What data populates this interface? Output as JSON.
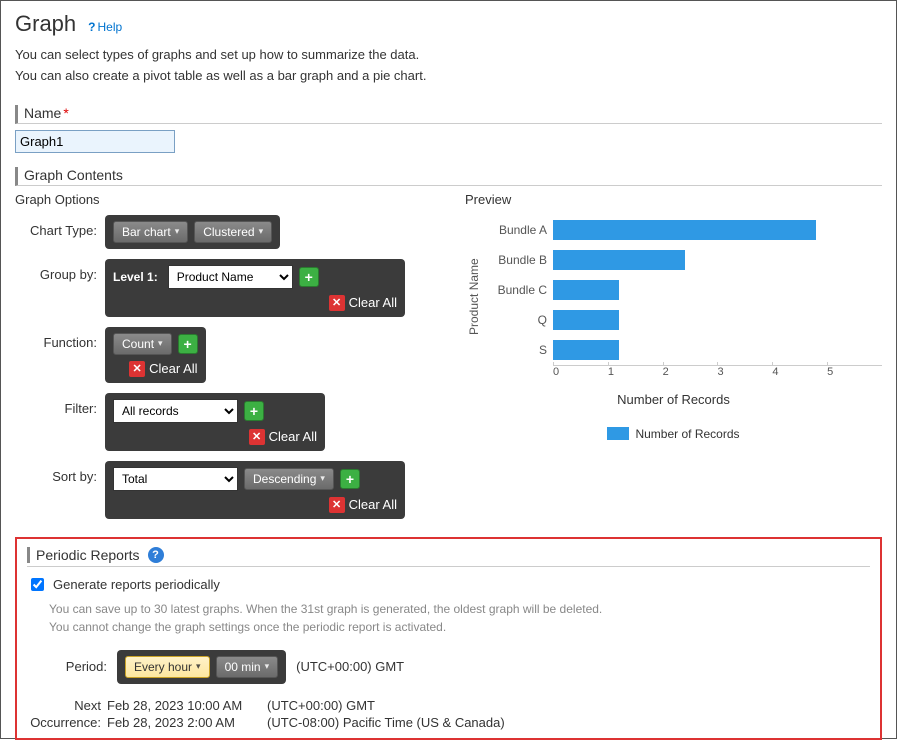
{
  "header": {
    "title": "Graph",
    "help": "Help"
  },
  "description": {
    "line1": "You can select types of graphs and set up how to summarize the data.",
    "line2": "You can also create a pivot table as well as a bar graph and a pie chart."
  },
  "name_section": {
    "label": "Name",
    "value": "Graph1"
  },
  "contents_section": {
    "label": "Graph Contents"
  },
  "options": {
    "heading": "Graph Options",
    "chart_type": {
      "label": "Chart Type:",
      "primary": "Bar chart",
      "secondary": "Clustered"
    },
    "group_by": {
      "label": "Group by:",
      "level_label": "Level 1:",
      "value": "Product Name",
      "clear": "Clear All"
    },
    "function": {
      "label": "Function:",
      "value": "Count",
      "clear": "Clear All"
    },
    "filter": {
      "label": "Filter:",
      "value": "All records",
      "clear": "Clear All"
    },
    "sort_by": {
      "label": "Sort by:",
      "field": "Total",
      "direction": "Descending",
      "clear": "Clear All"
    }
  },
  "preview": {
    "heading": "Preview"
  },
  "chart_data": {
    "type": "bar",
    "orientation": "horizontal",
    "categories": [
      "Bundle A",
      "Bundle B",
      "Bundle C",
      "Q",
      "S"
    ],
    "values": [
      4,
      2,
      1,
      1,
      1
    ],
    "ylabel": "Product Name",
    "xlabel": "Number of Records",
    "xlim": [
      0,
      5
    ],
    "xticks": [
      0,
      1,
      2,
      3,
      4,
      5
    ],
    "legend": "Number of Records",
    "bar_color": "#2f99e4"
  },
  "periodic": {
    "heading": "Periodic Reports",
    "checkbox_label": "Generate reports periodically",
    "checked": true,
    "note_line1": "You can save up to 30 latest graphs. When the 31st graph is generated, the oldest graph will be deleted.",
    "note_line2": "You cannot change the graph settings once the periodic report is activated.",
    "period_label": "Period:",
    "period_every": "Every hour",
    "period_minute": "00 min",
    "period_tz": "(UTC+00:00) GMT",
    "next_label": "Next Occurrence:",
    "next_label_1": "Next",
    "next_label_2": "Occurrence:",
    "row1_time": "Feb 28, 2023 10:00 AM",
    "row1_tz": "(UTC+00:00) GMT",
    "row2_time": "Feb 28, 2023 2:00 AM",
    "row2_tz": "(UTC-08:00) Pacific Time (US & Canada)"
  }
}
